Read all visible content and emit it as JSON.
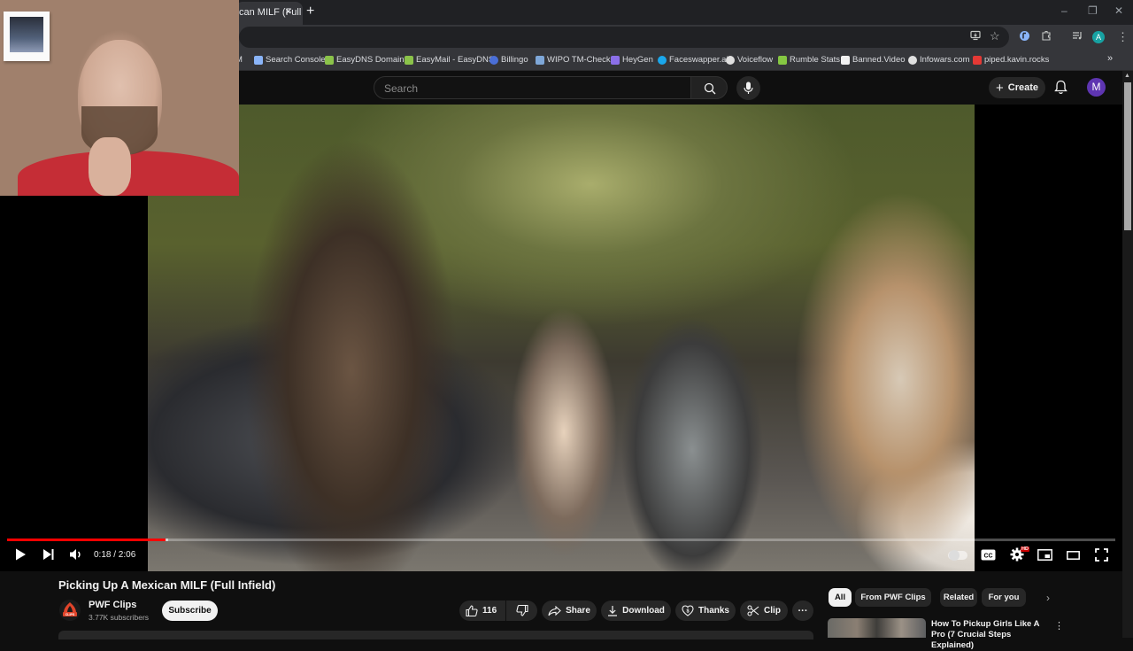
{
  "browser": {
    "tab_title": "can MILF (Full",
    "tab_close": "×",
    "new_tab": "+",
    "window_controls": {
      "minimize": "–",
      "restore": "❐",
      "close": "✕"
    },
    "profile_initial": "A",
    "bookmarks_overflow": "»",
    "bookmarks": [
      {
        "label": "M",
        "icon": "bookmark-fragment-icon",
        "color": "#dadce0"
      },
      {
        "label": "Search Console",
        "icon": "search-console-icon",
        "color": "#8ab4f8"
      },
      {
        "label": "EasyDNS Domains",
        "icon": "easydns-icon",
        "color": "#8bc34a"
      },
      {
        "label": "EasyMail - EasyDNS",
        "icon": "easymail-icon",
        "color": "#8bc34a"
      },
      {
        "label": "Billingo",
        "icon": "billingo-icon",
        "color": "#4a6fd8"
      },
      {
        "label": "WIPO TM-Check",
        "icon": "wipo-icon",
        "color": "#7ea7d8"
      },
      {
        "label": "HeyGen",
        "icon": "heygen-icon",
        "color": "#8b6fe8"
      },
      {
        "label": "Faceswapper.ai",
        "icon": "faceswapper-icon",
        "color": "#1aa7ec"
      },
      {
        "label": "Voiceflow",
        "icon": "voiceflow-icon",
        "color": "#e0e0e0"
      },
      {
        "label": "Rumble Stats",
        "icon": "rumble-icon",
        "color": "#85c742"
      },
      {
        "label": "Banned.Video",
        "icon": "banned-video-icon",
        "color": "#f1f1f1"
      },
      {
        "label": "Infowars.com",
        "icon": "infowars-icon",
        "color": "#e0e0e0"
      },
      {
        "label": "piped.kavin.rocks",
        "icon": "piped-icon",
        "color": "#e53935"
      }
    ]
  },
  "youtube": {
    "search": {
      "placeholder": "Search"
    },
    "create_label": "Create",
    "avatar_initial": "M",
    "player": {
      "current_time": "0:18",
      "duration": "2:06",
      "time_display": "0:18 / 2:06",
      "progress_fraction": 0.143,
      "buffered_fraction": 0.145,
      "quality_badge": "HD",
      "autoplay": false
    },
    "video": {
      "title": "Picking Up A Mexican MILF (Full Infield)",
      "channel_name": "PWF Clips",
      "channel_avatar_text": "CLIPS",
      "subscribers": "3.77K subscribers",
      "subscribe_label": "Subscribe",
      "like_count": "116",
      "share_label": "Share",
      "download_label": "Download",
      "thanks_label": "Thanks",
      "clip_label": "Clip",
      "more_label": "···"
    },
    "chips": [
      {
        "label": "All",
        "active": true
      },
      {
        "label": "From PWF Clips",
        "active": false
      },
      {
        "label": "Related",
        "active": false
      },
      {
        "label": "For you",
        "active": false
      }
    ],
    "chip_next": "›",
    "recommendations": [
      {
        "title": "How To Pickup Girls Like A Pro (7 Crucial Steps Explained)"
      }
    ],
    "accent_color": "#ff0000"
  }
}
